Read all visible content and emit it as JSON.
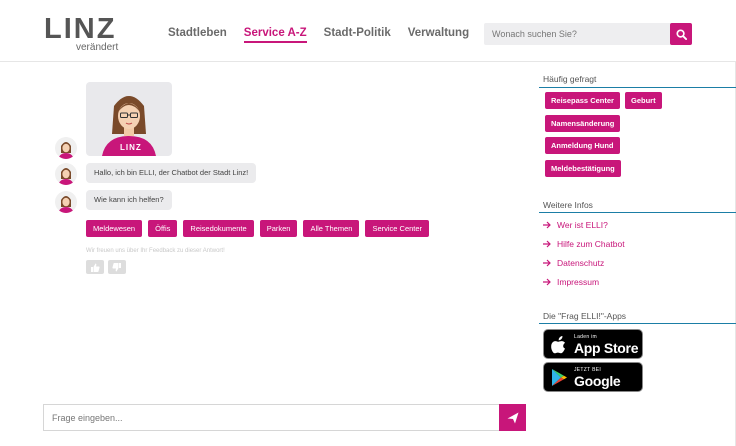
{
  "header": {
    "logo_word": "LINZ",
    "logo_sub": "verändert",
    "nav": [
      "Stadtleben",
      "Service A-Z",
      "Stadt-Politik",
      "Verwaltung"
    ],
    "search_placeholder": "Wonach suchen Sie?"
  },
  "chat": {
    "bot_card_label": "LINZ",
    "messages": [
      "Hallo, ich bin ELLI, der Chatbot der Stadt Linz!",
      "Wie kann ich helfen?"
    ],
    "chips": [
      "Meldewesen",
      "Öffis",
      "Reisedokumente",
      "Parken",
      "Alle Themen",
      "Service Center"
    ],
    "feedback_text": "Wir freuen uns über Ihr Feedback zu dieser Antwort!",
    "input_placeholder": "Frage eingeben..."
  },
  "sidebar": {
    "faq_title": "Häufig gefragt",
    "faq_tags": [
      "Reisepass Center",
      "Geburt",
      "Namensänderung",
      "Anmeldung Hund",
      "Meldebestätigung"
    ],
    "info_title": "Weitere Infos",
    "info_links": [
      "Wer ist ELLI?",
      "Hilfe zum Chatbot",
      "Datenschutz",
      "Impressum"
    ],
    "apps_title": "Die \"Frag ELLI!\"-Apps",
    "appstore_small": "Laden im",
    "appstore_big": "App Store",
    "googleplay_small": "JETZT BEI",
    "googleplay_big": "Google Play"
  },
  "colors": {
    "accent": "#c8167a",
    "rule": "#1b7ea6",
    "text": "#6a6a6a"
  }
}
